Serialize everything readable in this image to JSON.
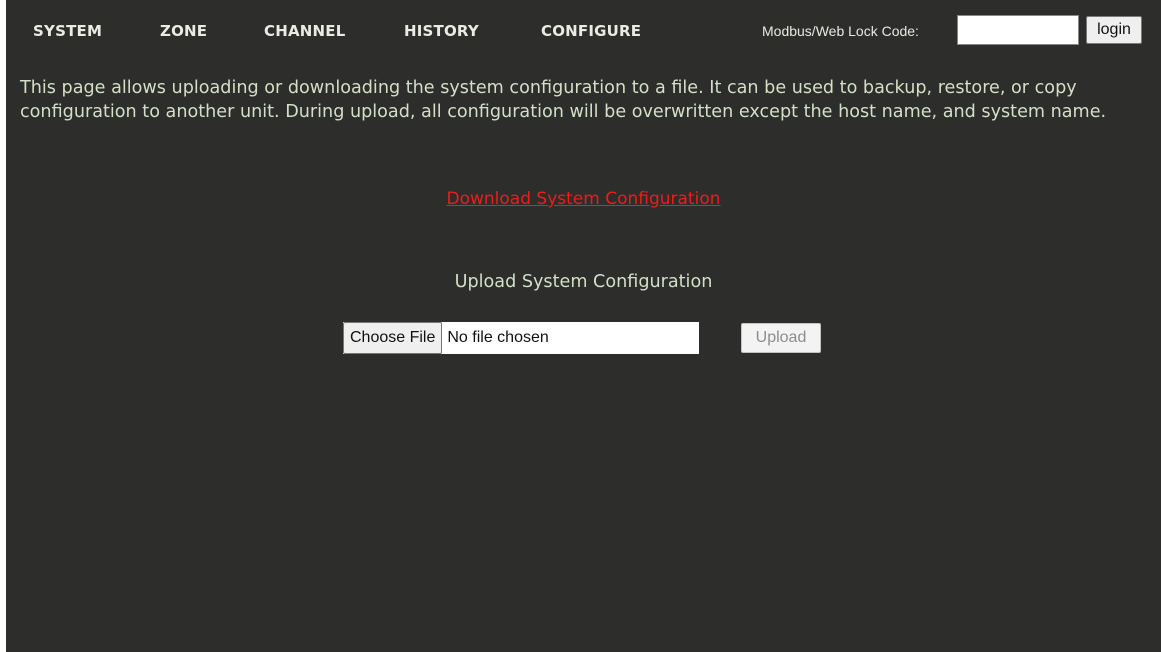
{
  "nav": {
    "items": [
      {
        "label": "SYSTEM"
      },
      {
        "label": "ZONE"
      },
      {
        "label": "CHANNEL"
      },
      {
        "label": "HISTORY"
      },
      {
        "label": "CONFIGURE"
      }
    ],
    "lock_code_label": "Modbus/Web Lock Code:",
    "lock_code_value": "",
    "login_label": "login"
  },
  "main": {
    "description": "This page allows uploading or downloading the system configuration to a file. It can be used to backup, restore, or copy configuration to another unit. During upload, all configuration will be overwritten except the host name, and system name.",
    "download_link": "Download System Configuration",
    "upload_title": "Upload System Configuration",
    "file_input": {
      "button_label": "Choose File",
      "status": "No file chosen"
    },
    "upload_button": "Upload"
  },
  "colors": {
    "background": "#2d2d2b",
    "text": "#d3dfc7",
    "nav_text": "#ecebe3",
    "link": "#ee1c1c"
  }
}
